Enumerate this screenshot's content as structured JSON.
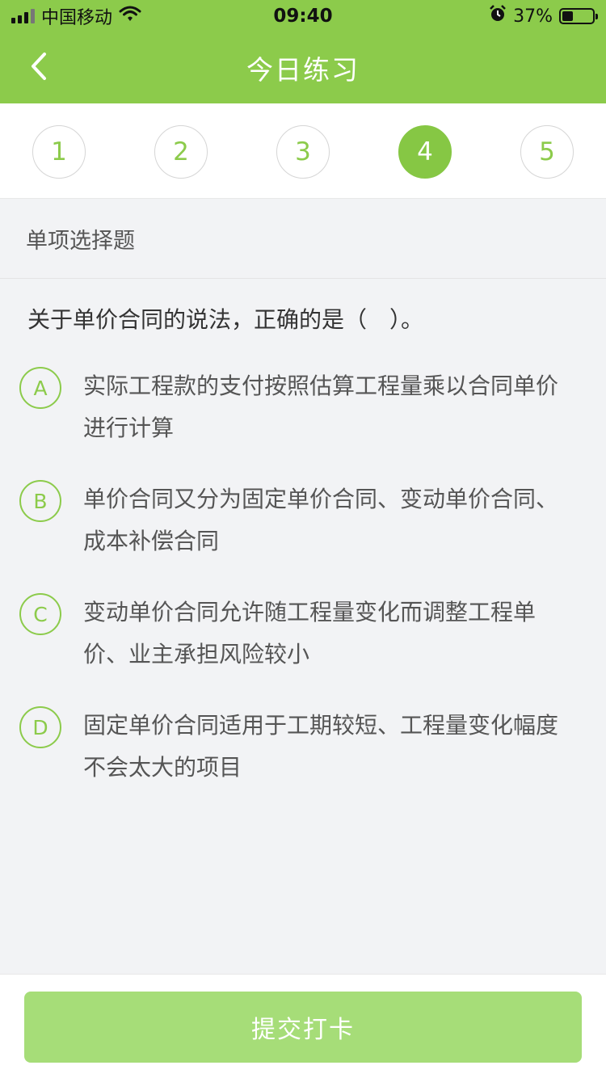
{
  "status_bar": {
    "carrier": "中国移动",
    "time": "09:40",
    "battery": "37%",
    "battery_level": 0.37
  },
  "nav": {
    "title": "今日练习"
  },
  "steps": [
    {
      "label": "1",
      "active": false
    },
    {
      "label": "2",
      "active": false
    },
    {
      "label": "3",
      "active": false
    },
    {
      "label": "4",
      "active": true
    },
    {
      "label": "5",
      "active": false
    }
  ],
  "question": {
    "type": "单项选择题",
    "text": "关于单价合同的说法，正确的是（　）。",
    "options": [
      {
        "letter": "A",
        "text": "实际工程款的支付按照估算工程量乘以合同单价进行计算"
      },
      {
        "letter": "B",
        "text": "单价合同又分为固定单价合同、变动单价合同、成本补偿合同"
      },
      {
        "letter": "C",
        "text": "变动单价合同允许随工程量变化而调整工程单价、业主承担风险较小"
      },
      {
        "letter": "D",
        "text": "固定单价合同适用于工期较短、工程量变化幅度不会太大的项目"
      }
    ]
  },
  "footer": {
    "submit_label": "提交打卡"
  },
  "colors": {
    "brand": "#8ccb4b",
    "active_step": "#86c744",
    "submit_disabled": "#a6dd78",
    "background": "#f2f3f5"
  },
  "icons": {
    "back": "chevron-left-icon",
    "signal": "signal-icon",
    "wifi": "wifi-icon",
    "alarm": "alarm-icon",
    "battery": "battery-icon"
  }
}
